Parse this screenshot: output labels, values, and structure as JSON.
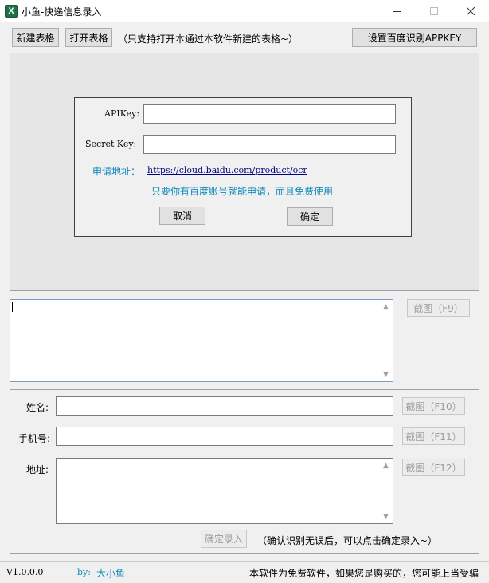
{
  "window": {
    "title": "小鱼-快递信息录入",
    "icon_letter": "X",
    "min_icon": "minimize-icon",
    "max_icon": "maximize-icon",
    "close_icon": "close-icon"
  },
  "toolbar": {
    "new_table": "新建表格",
    "open_table": "打开表格",
    "hint": "（只支持打开本通过本软件新建的表格~）",
    "set_appkey": "设置百度识别APPKEY"
  },
  "appkey_dialog": {
    "apikey_label": "APIKey:",
    "apikey_value": "",
    "secret_label": "Secret Key:",
    "secret_value": "",
    "apply_label": "申请地址：",
    "apply_url": "https://cloud.baidu.com/product/ocr",
    "note": "只要你有百度账号就能申请，而且免费使用",
    "cancel": "取消",
    "ok": "确定"
  },
  "capture": {
    "ocr_text": "",
    "screenshot_f9": "截图（F9）"
  },
  "form": {
    "name_label": "姓名:",
    "name_value": "",
    "name_capture": "截图（F10）",
    "phone_label": "手机号:",
    "phone_value": "",
    "phone_capture": "截图（F11）",
    "address_label": "地址:",
    "address_value": "",
    "address_capture": "截图（F12）",
    "confirm": "确定录入",
    "confirm_hint": "（确认识别无误后，可以点击确定录入~）"
  },
  "statusbar": {
    "version": "V1.0.0.0",
    "author_prefix": "by:",
    "author": "大小鱼",
    "notice": "本软件为免费软件，如果您是购买的，您可能上当受骗"
  },
  "colors": {
    "accent_teal": "#0f8bbd",
    "link_navy": "#000080",
    "excel_green": "#1e7145"
  }
}
